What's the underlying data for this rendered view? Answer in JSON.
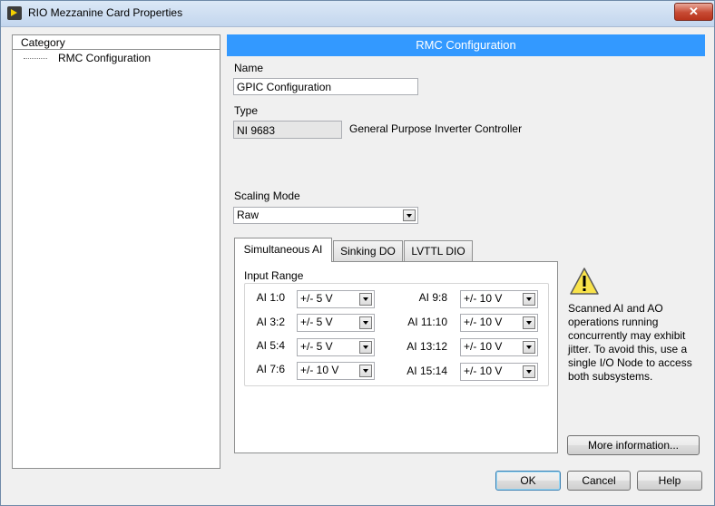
{
  "window": {
    "title": "RIO Mezzanine Card Properties",
    "close_label": "✕"
  },
  "category": {
    "header": "Category",
    "items": [
      "RMC Configuration"
    ]
  },
  "section": {
    "title": "RMC Configuration"
  },
  "name": {
    "label": "Name",
    "value": "GPIC Configuration"
  },
  "type": {
    "label": "Type",
    "value": "NI 9683",
    "description": "General Purpose Inverter Controller"
  },
  "scaling": {
    "label": "Scaling Mode",
    "value": "Raw"
  },
  "tabs": [
    "Simultaneous AI",
    "Sinking DO",
    "LVTTL DIO"
  ],
  "input_range": {
    "label": "Input Range",
    "channels": [
      {
        "name": "AI 1:0",
        "value": "+/- 5 V"
      },
      {
        "name": "AI 3:2",
        "value": "+/- 5 V"
      },
      {
        "name": "AI 5:4",
        "value": "+/- 5 V"
      },
      {
        "name": "AI 7:6",
        "value": "+/- 10 V"
      },
      {
        "name": "AI 9:8",
        "value": "+/- 10 V"
      },
      {
        "name": "AI 11:10",
        "value": "+/- 10 V"
      },
      {
        "name": "AI 13:12",
        "value": "+/- 10 V"
      },
      {
        "name": "AI 15:14",
        "value": "+/- 10 V"
      }
    ]
  },
  "warning": {
    "icon": "warning-icon",
    "text": "Scanned AI and AO operations running concurrently may exhibit jitter. To avoid this, use a single I/O Node to access both subsystems."
  },
  "buttons": {
    "more_info": "More information...",
    "ok": "OK",
    "cancel": "Cancel",
    "help": "Help"
  },
  "colors": {
    "banner": "#3399ff"
  }
}
